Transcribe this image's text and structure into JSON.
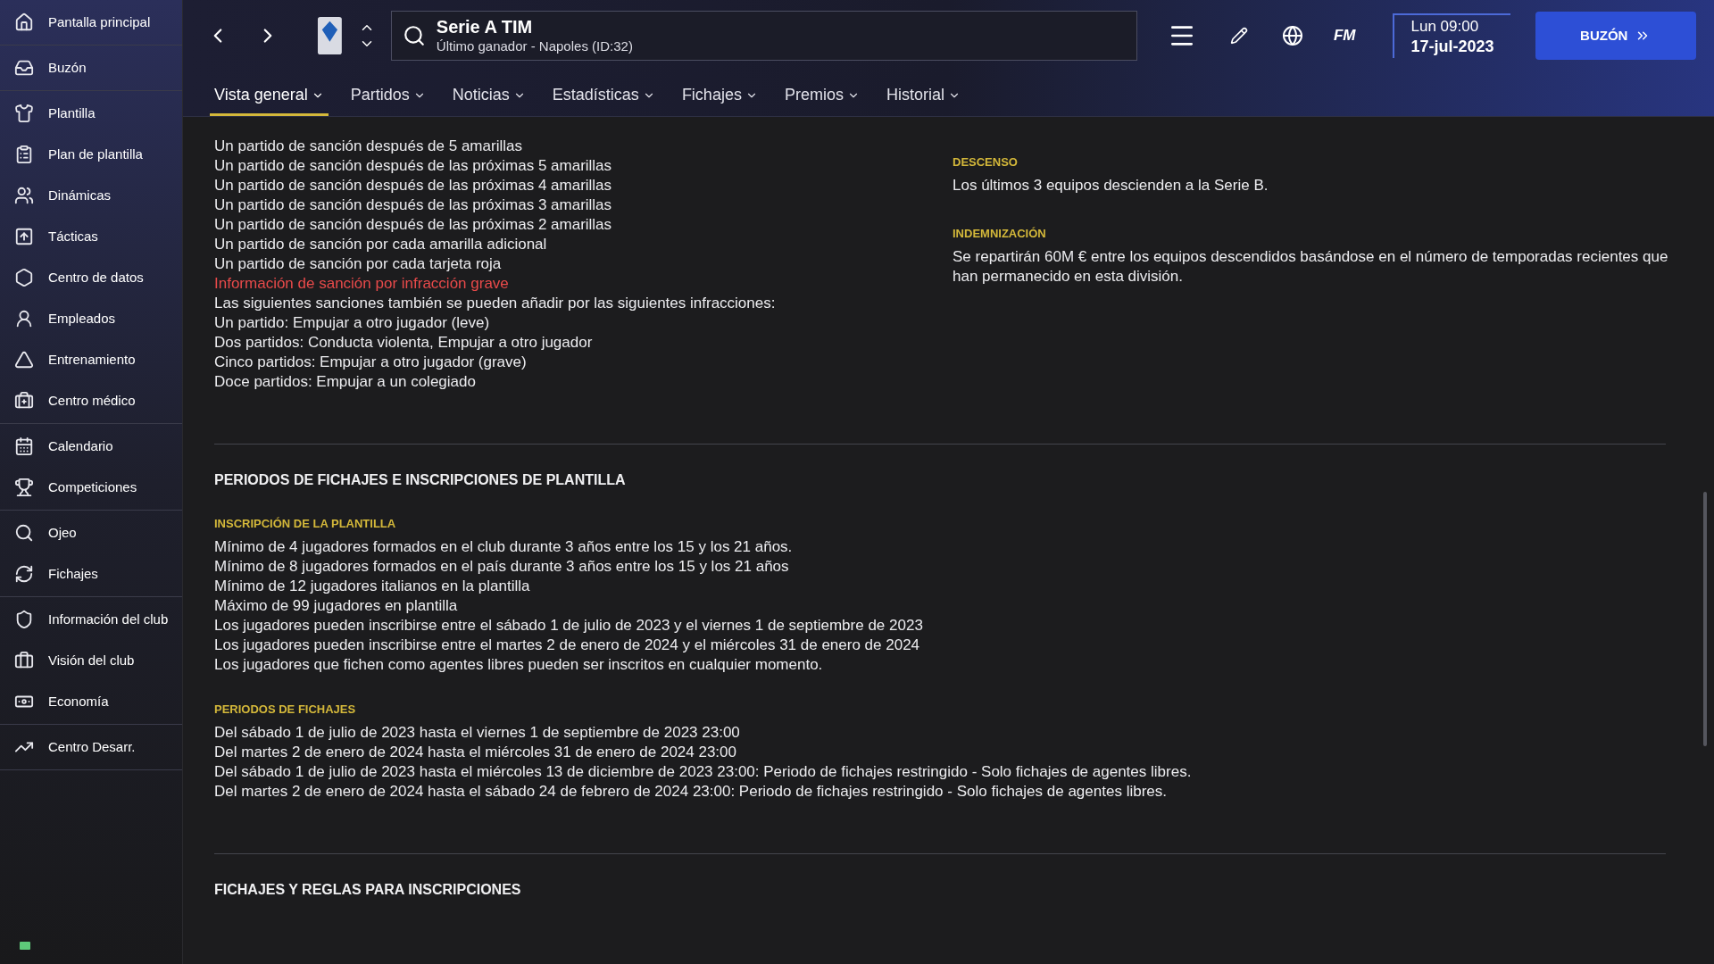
{
  "sidebar": {
    "groups": [
      [
        {
          "label": "Pantalla principal"
        }
      ],
      [
        {
          "label": "Buzón"
        }
      ],
      [
        {
          "label": "Plantilla"
        },
        {
          "label": "Plan de plantilla"
        },
        {
          "label": "Dinámicas"
        },
        {
          "label": "Tácticas"
        },
        {
          "label": "Centro de datos"
        },
        {
          "label": "Empleados"
        },
        {
          "label": "Entrenamiento"
        },
        {
          "label": "Centro médico"
        }
      ],
      [
        {
          "label": "Calendario"
        },
        {
          "label": "Competiciones"
        }
      ],
      [
        {
          "label": "Ojeo"
        },
        {
          "label": "Fichajes"
        }
      ],
      [
        {
          "label": "Información del club"
        },
        {
          "label": "Visión del club"
        },
        {
          "label": "Economía"
        }
      ],
      [
        {
          "label": "Centro Desarr."
        }
      ]
    ]
  },
  "header": {
    "title": "Serie A TIM",
    "subtitle": "Último ganador - Napoles (ID:32)",
    "logo_text": "FM",
    "day_time": "Lun 09:00",
    "date": "17-jul-2023",
    "inbox_button": "BUZÓN"
  },
  "tabs": [
    {
      "label": "Vista general",
      "selected": true
    },
    {
      "label": "Partidos",
      "selected": false
    },
    {
      "label": "Noticias",
      "selected": false
    },
    {
      "label": "Estadísticas",
      "selected": false
    },
    {
      "label": "Fichajes",
      "selected": false
    },
    {
      "label": "Premios",
      "selected": false
    },
    {
      "label": "Historial",
      "selected": false
    }
  ],
  "discipline_lines": [
    {
      "kind": "text",
      "text": "Un partido de sanción después de 5 amarillas"
    },
    {
      "kind": "text",
      "text": "Un partido de sanción después de las próximas 5 amarillas"
    },
    {
      "kind": "text",
      "text": "Un partido de sanción después de las próximas 4 amarillas"
    },
    {
      "kind": "text",
      "text": "Un partido de sanción después de las próximas 3 amarillas"
    },
    {
      "kind": "text",
      "text": "Un partido de sanción después de las próximas 2 amarillas"
    },
    {
      "kind": "text",
      "text": "Un partido de sanción por cada amarilla adicional"
    },
    {
      "kind": "text",
      "text": "Un partido de sanción por cada tarjeta roja"
    },
    {
      "kind": "link",
      "text": "Información de sanción por infracción grave"
    },
    {
      "kind": "text",
      "text": "Las siguientes sanciones también se pueden añadir por las siguientes infracciones:"
    },
    {
      "kind": "text",
      "text": "Un partido: Empujar a otro jugador (leve)"
    },
    {
      "kind": "text",
      "text": "Dos partidos: Conducta violenta, Empujar a otro jugador"
    },
    {
      "kind": "text",
      "text": "Cinco partidos: Empujar a otro jugador (grave)"
    },
    {
      "kind": "text",
      "text": "Doce partidos: Empujar a un colegiado"
    }
  ],
  "side_blocks": [
    {
      "heading": "DESCENSO",
      "lines": [
        "Los últimos 3 equipos descienden a la Serie B."
      ]
    },
    {
      "heading": "INDEMNIZACIÓN",
      "lines": [
        "Se repartirán 60M € entre los equipos descendidos basándose en el número de temporadas recientes que han permanecido en esta división."
      ]
    }
  ],
  "sections": [
    {
      "title": "PERIODOS DE FICHAJES E INSCRIPCIONES DE PLANTILLA",
      "blocks": [
        {
          "heading": "INSCRIPCIÓN DE LA PLANTILLA",
          "lines": [
            "Mínimo de 4 jugadores formados en el club durante 3 años entre los 15 y los 21 años.",
            "Mínimo de 8 jugadores formados en el país durante 3 años entre los 15 y los 21 años",
            "Mínimo de 12 jugadores italianos en la plantilla",
            "Máximo de 99 jugadores en plantilla",
            "Los jugadores pueden inscribirse entre el sábado 1 de julio de 2023 y el viernes 1 de septiembre de 2023",
            "Los jugadores pueden inscribirse entre el martes 2 de enero de 2024 y el miércoles 31 de enero de 2024",
            "Los jugadores que fichen como agentes libres pueden ser inscritos en cualquier momento."
          ]
        },
        {
          "heading": "PERIODOS DE FICHAJES",
          "lines": [
            "Del sábado 1 de julio de 2023 hasta el viernes 1 de septiembre de 2023 23:00",
            "Del martes 2 de enero de 2024 hasta el miércoles 31 de enero de 2024 23:00",
            "Del sábado 1 de julio de 2023 hasta el miércoles 13 de diciembre de 2023 23:00: Periodo de fichajes restringido - Solo fichajes de agentes libres.",
            "Del martes 2 de enero de 2024 hasta el sábado 24 de febrero de 2024 23:00: Periodo de fichajes restringido - Solo fichajes de agentes libres."
          ]
        }
      ]
    },
    {
      "title": "FICHAJES Y REGLAS PARA INSCRIPCIONES"
    }
  ]
}
